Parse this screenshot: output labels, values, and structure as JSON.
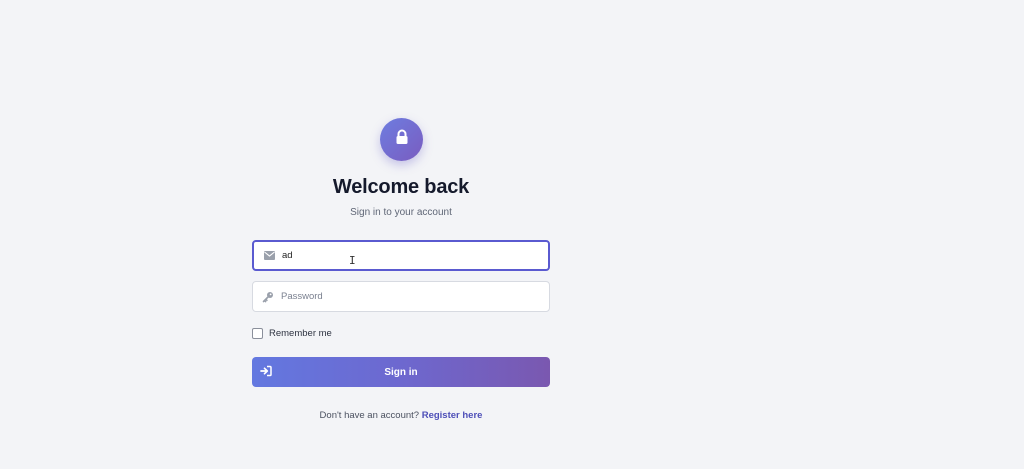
{
  "header": {
    "title": "Welcome back",
    "subtitle": "Sign in to your account"
  },
  "form": {
    "email": {
      "value": "ad",
      "placeholder": "",
      "icon": "envelope-icon"
    },
    "password": {
      "value": "",
      "placeholder": "Password",
      "icon": "key-icon"
    },
    "remember_label": "Remember me",
    "remember_checked": false,
    "submit_label": "Sign in",
    "submit_icon": "sign-in-icon"
  },
  "footer": {
    "prompt": "Don't have an account?",
    "register_label": "Register here"
  },
  "colors": {
    "accent": "#6366d8",
    "gradient_start": "#6378e0",
    "gradient_end": "#7a58b0",
    "background": "#f3f4f7"
  }
}
